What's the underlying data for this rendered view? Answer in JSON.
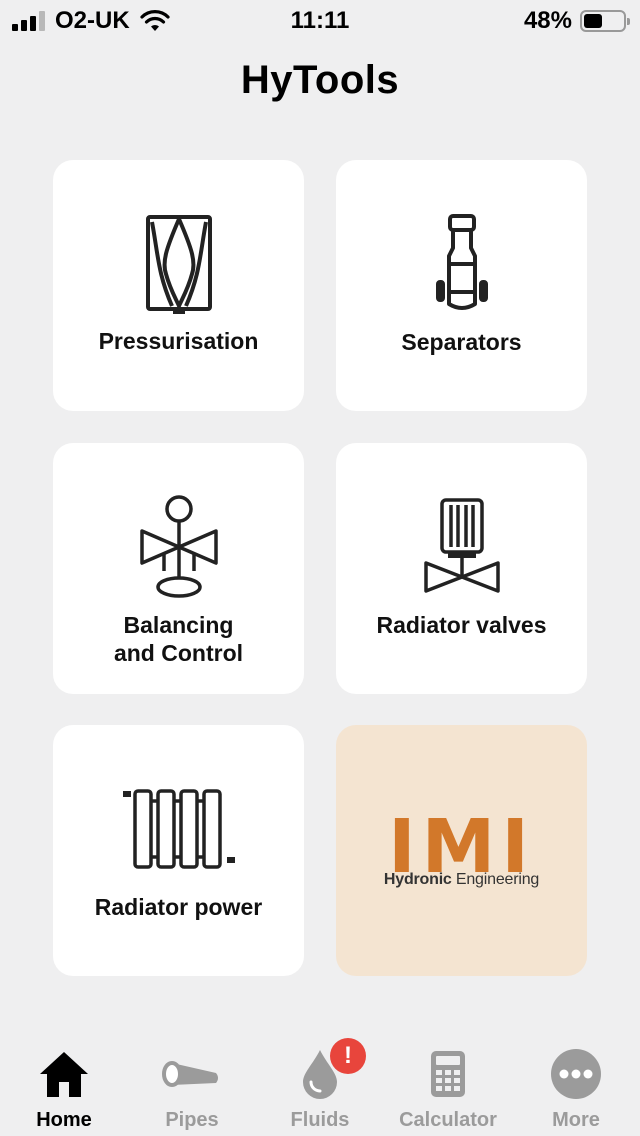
{
  "status_bar": {
    "carrier": "O2-UK",
    "time": "11:11",
    "battery_percent": "48%",
    "battery_level": 0.48
  },
  "app": {
    "title": "HyTools"
  },
  "tiles": [
    {
      "label": "Pressurisation",
      "icon": "pressurisation-icon"
    },
    {
      "label": "Separators",
      "icon": "separator-icon"
    },
    {
      "label": "Balancing\nand Control",
      "icon": "balancing-valve-icon"
    },
    {
      "label": "Radiator valves",
      "icon": "radiator-valve-icon"
    },
    {
      "label": "Radiator power",
      "icon": "radiator-icon"
    }
  ],
  "brand": {
    "logo_text": "IMI",
    "tagline_bold": "Hydronic",
    "tagline_light": "Engineering",
    "color": "#d2782a"
  },
  "tabs": [
    {
      "label": "Home",
      "icon": "home-icon",
      "active": true
    },
    {
      "label": "Pipes",
      "icon": "pipe-icon",
      "active": false
    },
    {
      "label": "Fluids",
      "icon": "droplet-icon",
      "active": false,
      "badge": "!"
    },
    {
      "label": "Calculator",
      "icon": "calculator-icon",
      "active": false
    },
    {
      "label": "More",
      "icon": "more-icon",
      "active": false
    }
  ]
}
